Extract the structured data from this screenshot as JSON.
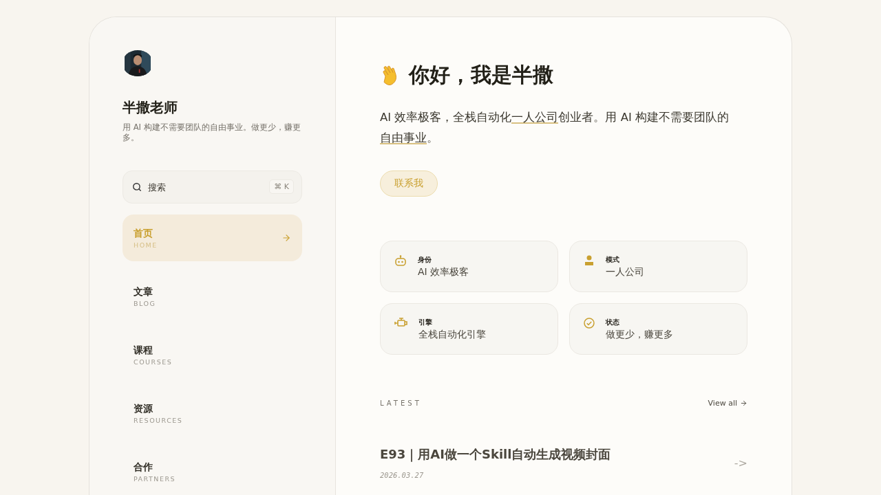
{
  "profile": {
    "name": "半撒老师",
    "tagline": "用 AI 构建不需要团队的自由事业。做更少，赚更多。"
  },
  "search": {
    "placeholder": "搜索",
    "shortcut": "⌘ K"
  },
  "nav": [
    {
      "label": "首页",
      "sublabel": "HOME",
      "selected": true
    },
    {
      "label": "文章",
      "sublabel": "BLOG",
      "selected": false
    },
    {
      "label": "课程",
      "sublabel": "COURSES",
      "selected": false
    },
    {
      "label": "资源",
      "sublabel": "RESOURCES",
      "selected": false
    },
    {
      "label": "合作",
      "sublabel": "PARTNERS",
      "selected": false
    }
  ],
  "hero": {
    "title": "你好，我是半撒",
    "intro": [
      {
        "text": "AI 效率极客，全栈自动化",
        "underline": false
      },
      {
        "text": "一人公司",
        "underline": true
      },
      {
        "text": "创业者。用 AI 构建不需要团队的",
        "underline": false
      },
      {
        "text": "自由事业",
        "underline": true
      },
      {
        "text": "。",
        "underline": false
      }
    ],
    "contact_button": "联系我"
  },
  "facts": [
    {
      "kind": "robot",
      "label": "身份",
      "value": "AI 效率极客"
    },
    {
      "kind": "person",
      "label": "模式",
      "value": "一人公司"
    },
    {
      "kind": "engine",
      "label": "引擎",
      "value": "全栈自动化引擎"
    },
    {
      "kind": "check",
      "label": "状态",
      "value": "做更少，赚更多"
    }
  ],
  "latest": {
    "heading": "LATEST",
    "view_all": "View all",
    "posts": [
      {
        "title": "E93｜用AI做一个Skill自动生成视频封面",
        "date": "2026.03.27",
        "arrow": "->"
      }
    ]
  }
}
